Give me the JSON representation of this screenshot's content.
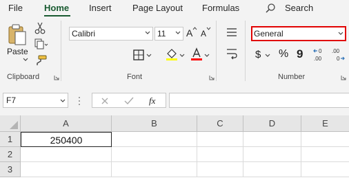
{
  "tabs": [
    "File",
    "Home",
    "Insert",
    "Page Layout",
    "Formulas"
  ],
  "search_label": "Search",
  "clipboard": {
    "paste_label": "Paste",
    "group_label": "Clipboard"
  },
  "font": {
    "name": "Calibri",
    "size": "11",
    "group_label": "Font",
    "grow_label": "A",
    "shrink_label": "A",
    "fill_color": "#ffff00",
    "text_color": "#ff0000"
  },
  "number": {
    "format": "General",
    "group_label": "Number",
    "currency_symbol": "$",
    "percent_symbol": "%",
    "comma_symbol": "9"
  },
  "name_box": "F7",
  "formula_bar": {
    "fx_label": "fx",
    "content": ""
  },
  "columns": [
    "A",
    "B",
    "C",
    "D",
    "E"
  ],
  "rows": [
    "1",
    "2",
    "3"
  ],
  "cells": {
    "A1": "250400"
  },
  "highlight_color": "#e00000",
  "accent_color": "#185a30"
}
